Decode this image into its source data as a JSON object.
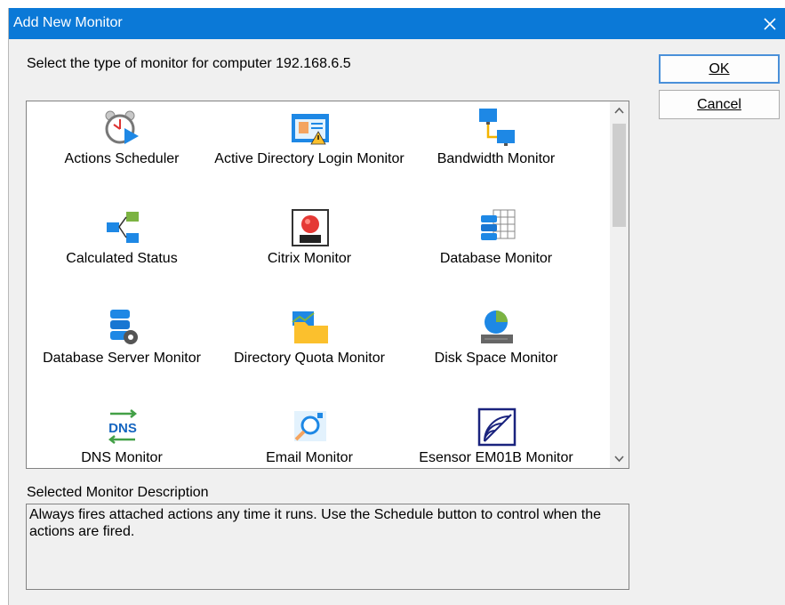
{
  "window": {
    "title": "Add New Monitor"
  },
  "prompt": "Select the type of monitor for computer 192.168.6.5",
  "buttons": {
    "ok": "OK",
    "cancel": "Cancel"
  },
  "monitors": [
    {
      "label": "Actions Scheduler",
      "icon": "alarm-clock-icon"
    },
    {
      "label": "Active Directory Login Monitor",
      "icon": "id-card-warning-icon"
    },
    {
      "label": "Bandwidth Monitor",
      "icon": "network-computers-icon"
    },
    {
      "label": "Calculated Status",
      "icon": "branch-diagram-icon"
    },
    {
      "label": "Citrix Monitor",
      "icon": "red-ball-icon"
    },
    {
      "label": "Database Monitor",
      "icon": "database-grid-icon"
    },
    {
      "label": "Database Server Monitor",
      "icon": "database-gear-icon"
    },
    {
      "label": "Directory Quota Monitor",
      "icon": "folder-chart-icon"
    },
    {
      "label": "Disk Space Monitor",
      "icon": "disk-pie-icon"
    },
    {
      "label": "DNS Monitor",
      "icon": "dns-arrows-icon"
    },
    {
      "label": "Email Monitor",
      "icon": "magnifier-icon"
    },
    {
      "label": "Esensor EM01B Monitor",
      "icon": "sensor-signal-icon"
    }
  ],
  "description": {
    "label": "Selected Monitor Description",
    "text": "Always fires attached actions any time it runs.  Use the Schedule button to control when the actions are fired."
  },
  "colors": {
    "titlebar": "#0b79d7",
    "dialog_bg": "#f0f0f0"
  }
}
